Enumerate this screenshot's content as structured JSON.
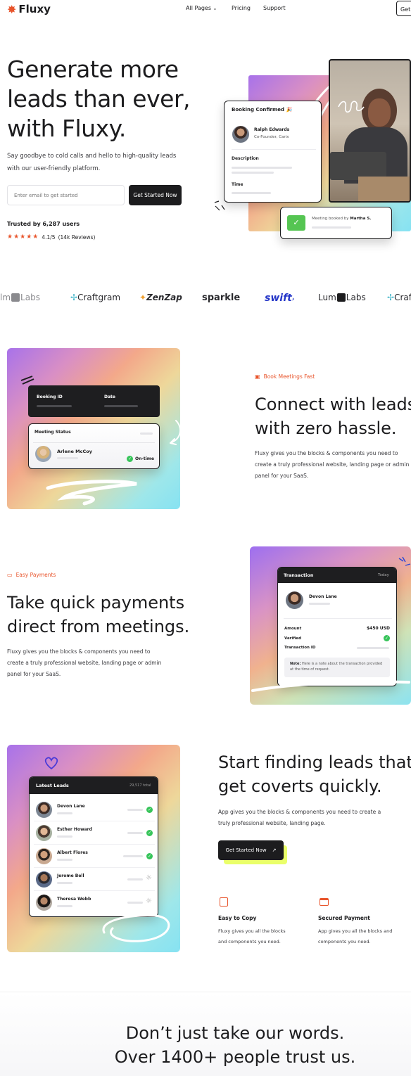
{
  "nav": {
    "brand": "Fluxy",
    "links": [
      "All Pages",
      "Pricing",
      "Support"
    ],
    "cta": "Get"
  },
  "hero": {
    "title_lines": [
      "Generate more",
      "leads than ever,",
      "with Fluxy."
    ],
    "subtitle_lines": [
      "Say goodbye to cold calls and hello to high-quality leads",
      "with our user-friendly platform."
    ],
    "email_placeholder": "Enter email to get started",
    "cta": "Get Started Now",
    "trusted": "Trusted by 6,287 users",
    "rating": "4.1/5",
    "reviews": "(14k Reviews)",
    "stars": 5,
    "booking_card": {
      "title": "Booking Confirmed 🎉",
      "person": "Ralph Edwards",
      "role": "Co-Founder, Carix",
      "description_label": "Description",
      "time_label": "Time"
    },
    "toast": {
      "text": "Meeting booked by",
      "name": "Martha S."
    }
  },
  "logos": [
    "Labs",
    "Craftgram",
    "ZenZap",
    "sparkle",
    "swift",
    "Lum",
    "Labs",
    "Craf"
  ],
  "feature1": {
    "tag": "Book Meetings Fast",
    "title_lines": [
      "Connect with leads",
      "with zero hassle."
    ],
    "body_lines": [
      "Fluxy gives you the blocks & components you need to",
      "create a truly professional website, landing page or admin",
      "panel for your SaaS."
    ],
    "booking_id": "Booking ID",
    "date": "Date",
    "status_label": "Meeting Status",
    "person": "Arlene McCoy",
    "status": "On-time"
  },
  "feature2": {
    "tag": "Easy Payments",
    "title_lines": [
      "Take quick payments",
      "direct from meetings."
    ],
    "body_lines": [
      "Fluxy gives you the blocks & components you need to",
      "create a truly professional website, landing page or admin",
      "panel for your SaaS."
    ],
    "card": {
      "title": "Transaction",
      "when": "Today",
      "person": "Devon Lane",
      "amount_label": "Amount",
      "amount": "$450 USD",
      "verified_label": "Verified",
      "txn_label": "Transaction ID",
      "note_bold": "Note:",
      "note": "Here is a note about the transaction provided at the time of request."
    }
  },
  "feature3": {
    "title_lines": [
      "Start finding leads that",
      "get coverts quickly."
    ],
    "body_lines": [
      "App gives you the blocks & components you need to create a",
      "truly professional website, landing page."
    ],
    "cta": "Get Started Now",
    "leads": {
      "title": "Latest Leads",
      "total": "29,517 total",
      "items": [
        {
          "name": "Devon Lane",
          "done": true
        },
        {
          "name": "Esther Howard",
          "done": true
        },
        {
          "name": "Albert Flores",
          "done": true
        },
        {
          "name": "Jerome Bell",
          "done": false
        },
        {
          "name": "Theresa Webb",
          "done": false
        }
      ]
    },
    "mini": [
      {
        "title": "Easy to Copy",
        "body_lines": [
          "Fluxy gives you all the blocks",
          "and components you need."
        ]
      },
      {
        "title": "Secured Payment",
        "body_lines": [
          "App gives you all the blocks and",
          "components you need."
        ]
      }
    ]
  },
  "testimonials": {
    "title_lines": [
      "Don’t just take our words.",
      "Over 1400+ people trust us."
    ]
  },
  "colors": {
    "accent": "#e8542b",
    "dark": "#1c1c1e",
    "green": "#37c45a",
    "lime": "#eaff6a"
  }
}
